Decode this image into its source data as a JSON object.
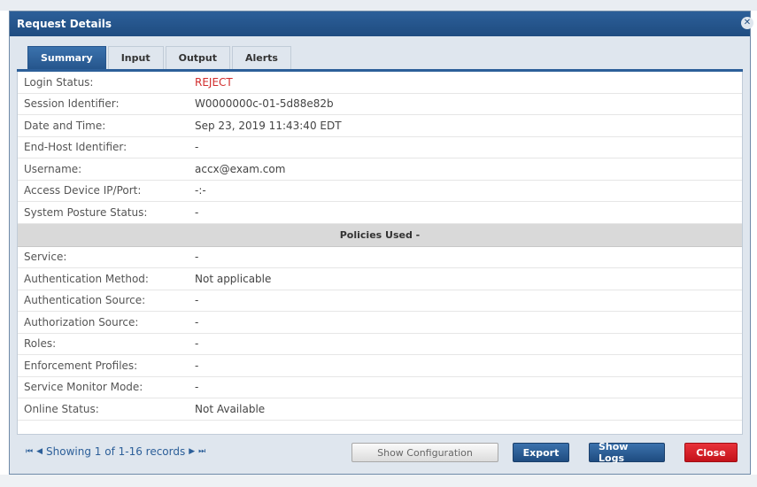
{
  "dialog": {
    "title": "Request Details"
  },
  "tabs": [
    {
      "label": "Summary",
      "active": true
    },
    {
      "label": "Input",
      "active": false
    },
    {
      "label": "Output",
      "active": false
    },
    {
      "label": "Alerts",
      "active": false
    }
  ],
  "summary": {
    "login_status": {
      "label": "Login Status:",
      "value": "REJECT"
    },
    "session_id": {
      "label": "Session Identifier:",
      "value": "W0000000c-01-5d88e82b"
    },
    "date_time": {
      "label": "Date and Time:",
      "value": "Sep 23, 2019 11:43:40 EDT"
    },
    "end_host": {
      "label": "End-Host Identifier:",
      "value": "-"
    },
    "username": {
      "label": "Username:",
      "value": "accx@exam.com"
    },
    "access_device": {
      "label": "Access Device IP/Port:",
      "value": "-:-"
    },
    "posture": {
      "label": "System Posture Status:",
      "value": "-"
    }
  },
  "policies": {
    "header": "Policies Used -",
    "service": {
      "label": "Service:",
      "value": "-"
    },
    "auth_method": {
      "label": "Authentication Method:",
      "value": "Not applicable"
    },
    "auth_source": {
      "label": "Authentication Source:",
      "value": "-"
    },
    "authz_source": {
      "label": "Authorization Source:",
      "value": "-"
    },
    "roles": {
      "label": "Roles:",
      "value": "-"
    },
    "enforcement": {
      "label": "Enforcement Profiles:",
      "value": "-"
    },
    "monitor_mode": {
      "label": "Service Monitor Mode:",
      "value": "-"
    },
    "online_status": {
      "label": "Online Status:",
      "value": "Not Available"
    }
  },
  "pager": {
    "first": "⏮",
    "prev": "◀",
    "text": "Showing 1 of 1-16 records",
    "next": "▶",
    "last": "⏭"
  },
  "buttons": {
    "show_config": "Show Configuration",
    "export": "Export",
    "show_logs": "Show Logs",
    "close": "Close"
  },
  "colors": {
    "accent": "#1f4c80",
    "reject": "#d12d2d",
    "close": "#c4121a"
  }
}
